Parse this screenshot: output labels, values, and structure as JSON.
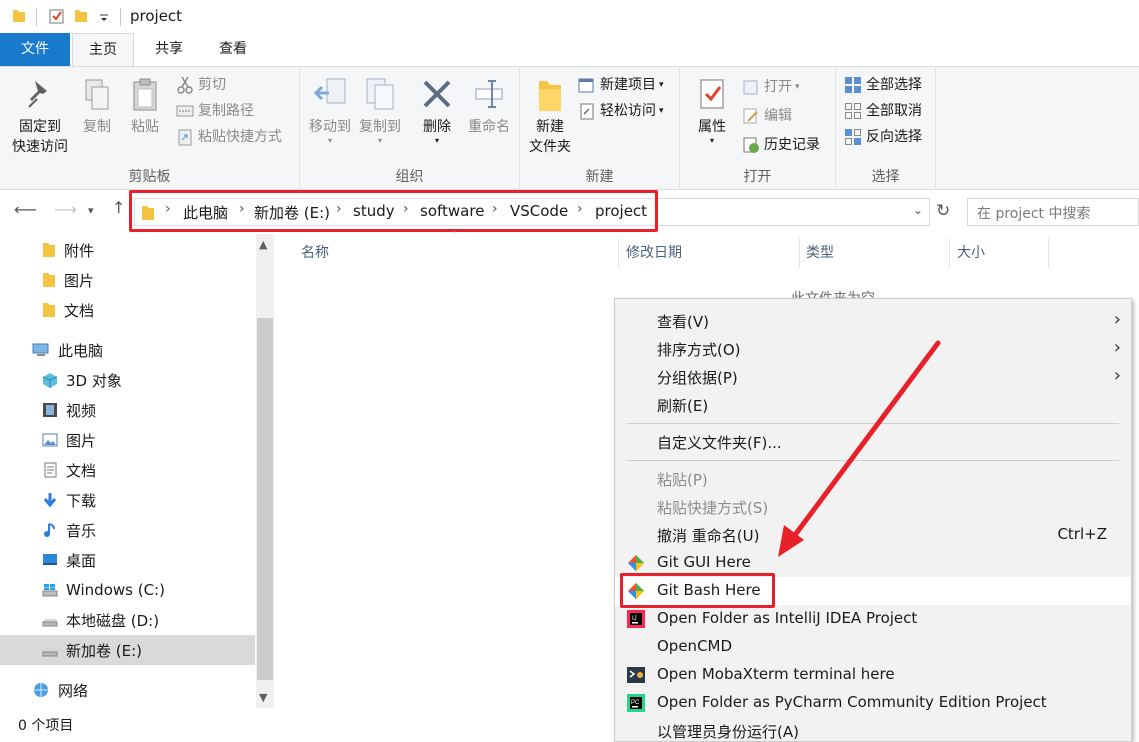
{
  "window": {
    "title": "project"
  },
  "ribbon_tabs": [
    "文件",
    "主页",
    "共享",
    "查看"
  ],
  "ribbon": {
    "clipboard": {
      "label": "剪贴板",
      "pin": "固定到\n快速访问",
      "pin_line1": "固定到",
      "pin_line2": "快速访问",
      "copy": "复制",
      "paste": "粘贴",
      "cut": "剪切",
      "copy_path": "复制路径",
      "paste_shortcut": "粘贴快捷方式"
    },
    "organize": {
      "label": "组织",
      "move_to": "移动到",
      "copy_to": "复制到",
      "delete": "删除",
      "rename": "重命名"
    },
    "new": {
      "label": "新建",
      "new_folder_line1": "新建",
      "new_folder_line2": "文件夹",
      "new_item": "新建项目",
      "easy_access": "轻松访问"
    },
    "open": {
      "label": "打开",
      "properties": "属性",
      "open": "打开",
      "edit": "编辑",
      "history": "历史记录"
    },
    "select": {
      "label": "选择",
      "select_all": "全部选择",
      "select_none": "全部取消",
      "invert": "反向选择"
    }
  },
  "address": {
    "crumbs": [
      "此电脑",
      "新加卷 (E:)",
      "study",
      "software",
      "VSCode",
      "project"
    ],
    "search_placeholder": "在 project 中搜索"
  },
  "nav_pane": {
    "items": [
      {
        "label": "附件",
        "icon": "folder-icon"
      },
      {
        "label": "图片",
        "icon": "folder-icon"
      },
      {
        "label": "文档",
        "icon": "folder-icon"
      },
      {
        "label": "此电脑",
        "icon": "computer-icon"
      },
      {
        "label": "3D 对象",
        "icon": "3d-objects-icon"
      },
      {
        "label": "视频",
        "icon": "video-icon"
      },
      {
        "label": "图片",
        "icon": "pictures-icon"
      },
      {
        "label": "文档",
        "icon": "documents-icon"
      },
      {
        "label": "下载",
        "icon": "download-icon"
      },
      {
        "label": "音乐",
        "icon": "music-icon"
      },
      {
        "label": "桌面",
        "icon": "desktop-icon"
      },
      {
        "label": "Windows (C:)",
        "icon": "windows-drive-icon"
      },
      {
        "label": "本地磁盘 (D:)",
        "icon": "drive-icon"
      },
      {
        "label": "新加卷 (E:)",
        "icon": "drive-icon"
      },
      {
        "label": "网络",
        "icon": "network-icon"
      }
    ]
  },
  "file_list": {
    "columns": [
      "名称",
      "修改日期",
      "类型",
      "大小"
    ],
    "empty_text": "此文件夹为空"
  },
  "status": {
    "item_count": "0 个项目"
  },
  "context_menu": {
    "items": [
      {
        "label": "查看(V)",
        "submenu": true
      },
      {
        "label": "排序方式(O)",
        "submenu": true
      },
      {
        "label": "分组依据(P)",
        "submenu": true
      },
      {
        "label": "刷新(E)"
      },
      {
        "label": "自定义文件夹(F)..."
      },
      {
        "label": "粘贴(P)",
        "disabled": true
      },
      {
        "label": "粘贴快捷方式(S)",
        "disabled": true
      },
      {
        "label": "撤消 重命名(U)",
        "shortcut": "Ctrl+Z"
      },
      {
        "label": "Git GUI Here",
        "icon": "git-icon"
      },
      {
        "label": "Git Bash Here",
        "icon": "git-icon"
      },
      {
        "label": "Open Folder as IntelliJ IDEA Project",
        "icon": "intellij-icon"
      },
      {
        "label": "OpenCMD"
      },
      {
        "label": "Open MobaXterm terminal here",
        "icon": "mobaxterm-icon"
      },
      {
        "label": "Open Folder as PyCharm Community Edition Project",
        "icon": "pycharm-icon"
      },
      {
        "label": "以管理员身份运行(A)"
      }
    ]
  },
  "colors": {
    "accent": "#1979ca",
    "annotation": "#e8202a",
    "folder": "#f5c342"
  }
}
